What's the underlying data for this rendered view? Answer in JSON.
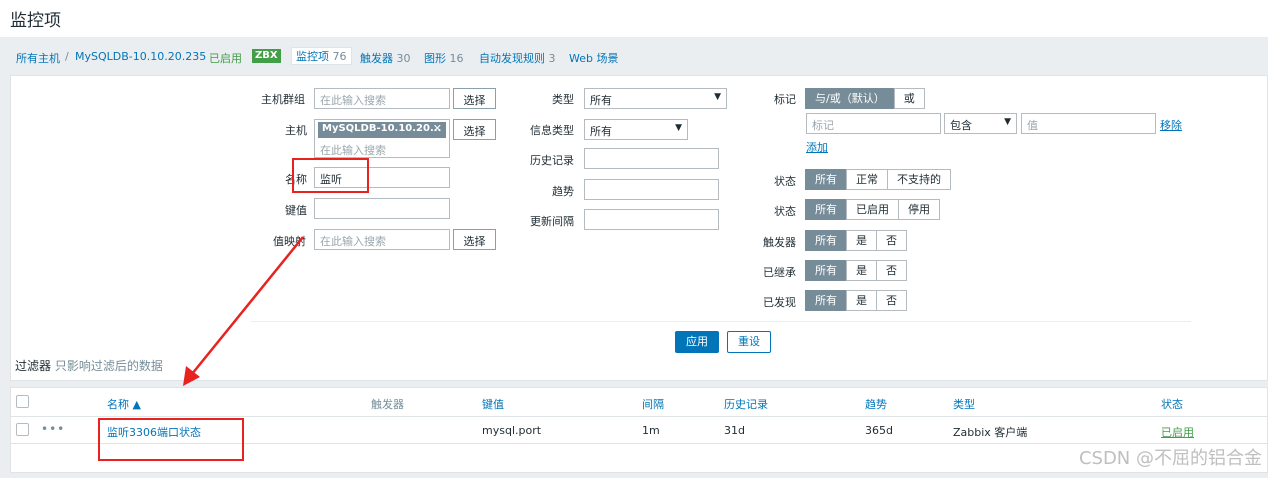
{
  "page": {
    "title": "监控项"
  },
  "breadcrumb": {
    "all_hosts": "所有主机",
    "separator": "/",
    "host": "MySQLDB-10.10.20.235",
    "enabled": "已启用",
    "zbx": "ZBX",
    "tabs": [
      {
        "label": "监控项",
        "count": "76"
      },
      {
        "label": "触发器",
        "count": "30"
      },
      {
        "label": "图形",
        "count": "16"
      },
      {
        "label": "自动发现规则",
        "count": "3"
      },
      {
        "label": "Web 场景",
        "count": ""
      }
    ]
  },
  "filter": {
    "host_group_label": "主机群组",
    "host_group_placeholder": "在此输入搜索",
    "select_btn": "选择",
    "host_label": "主机",
    "host_tag": "MySQLDB-10.10.20...",
    "host_tag_close": "✕",
    "host_placeholder": "在此输入搜索",
    "name_label": "名称",
    "name_value": "监听",
    "key_label": "键值",
    "key_value": "",
    "valuemap_label": "值映射",
    "valuemap_placeholder": "在此输入搜索",
    "type_label": "类型",
    "type_value": "所有",
    "info_type_label": "信息类型",
    "info_type_value": "所有",
    "history_label": "历史记录",
    "trends_label": "趋势",
    "interval_label": "更新间隔",
    "tags_label": "标记",
    "tags_and_or": "与/或（默认）",
    "tags_or": "或",
    "tag_placeholder": "标记",
    "tag_op": "包含",
    "tag_value_placeholder": "值",
    "remove_link": "移除",
    "add_link": "添加",
    "state_label": "状态",
    "state_options": [
      "所有",
      "正常",
      "不支持的"
    ],
    "status_label": "状态",
    "status_options": [
      "所有",
      "已启用",
      "停用"
    ],
    "triggers_label": "触发器",
    "triggers_options": [
      "所有",
      "是",
      "否"
    ],
    "inherited_label": "已继承",
    "inherited_options": [
      "所有",
      "是",
      "否"
    ],
    "discovered_label": "已发现",
    "discovered_options": [
      "所有",
      "是",
      "否"
    ],
    "apply_btn": "应用",
    "reset_btn": "重设"
  },
  "filter_note": {
    "title": "过滤器",
    "subtitle": "只影响过滤后的数据"
  },
  "table": {
    "headers": {
      "name": "名称 ▲",
      "triggers": "触发器",
      "key": "键值",
      "interval": "间隔",
      "history": "历史记录",
      "trends": "趋势",
      "type": "类型",
      "status": "状态"
    },
    "rows": [
      {
        "menu": "•••",
        "name": "监听3306端口状态",
        "triggers": "",
        "key": "mysql.port",
        "interval": "1m",
        "history": "31d",
        "trends": "365d",
        "type": "Zabbix 客户端",
        "status": "已启用"
      }
    ]
  },
  "watermark": "CSDN @不屈的铝合金",
  "colors": {
    "accent": "#0275b8",
    "enabled": "#429e47",
    "annotation": "#e8231f"
  }
}
